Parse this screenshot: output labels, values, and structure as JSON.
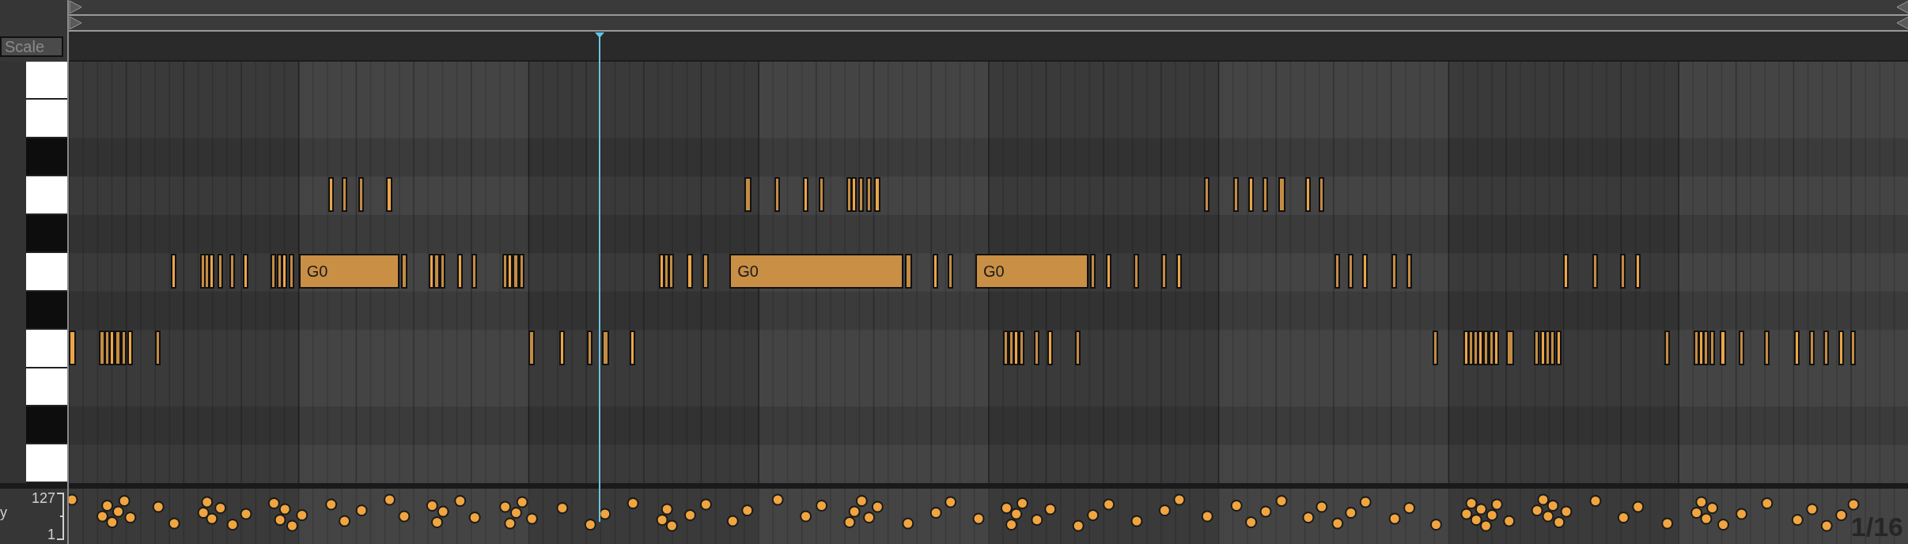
{
  "scale_button": {
    "label": "Scale"
  },
  "piano_keys": [
    {
      "kind": "white"
    },
    {
      "kind": "white"
    },
    {
      "kind": "black"
    },
    {
      "kind": "white"
    },
    {
      "kind": "black"
    },
    {
      "kind": "white"
    },
    {
      "kind": "black"
    },
    {
      "kind": "white"
    },
    {
      "kind": "white"
    },
    {
      "kind": "black"
    },
    {
      "kind": "white"
    }
  ],
  "long_notes": [
    {
      "label": "G0"
    },
    {
      "label": "G0"
    },
    {
      "label": "G0"
    }
  ],
  "velocity_lane": {
    "label": "y",
    "max": "127",
    "min": "1"
  },
  "grid_resolution": "1/16"
}
